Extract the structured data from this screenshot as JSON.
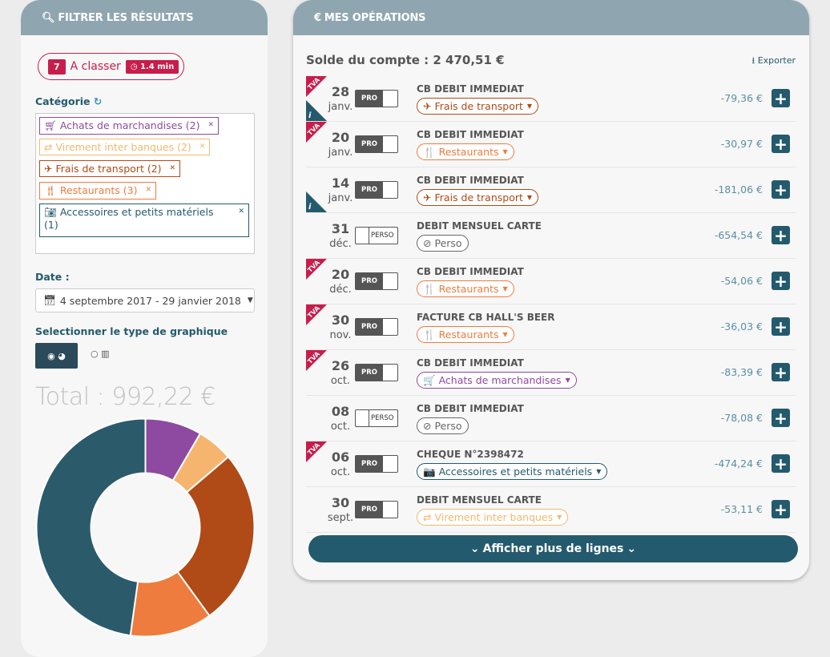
{
  "filter": {
    "title": "FILTRER LES RÉSULTATS",
    "badge_count": "7",
    "badge_label": "A classer",
    "badge_time": "1.4 min",
    "category_label": "Catégorie",
    "tags": [
      {
        "label": "Achats de marchandises (2)",
        "color": "#8e4aa0"
      },
      {
        "label": "Virement inter banques (2)",
        "color": "#f0b96e"
      },
      {
        "label": "Frais de transport (2)",
        "color": "#b04a17"
      },
      {
        "label": "Restaurants (3)",
        "color": "#ed7c3e"
      },
      {
        "label": "Accessoires et petits matériels (1)",
        "color": "#245a6e"
      }
    ],
    "date_label": "Date :",
    "date_value": "4 septembre 2017 - 29 janvier 2018",
    "graph_label": "Selectionner le type de graphique",
    "total": "Total : 992,22 €"
  },
  "chart_data": {
    "type": "pie",
    "categories": [
      "Achats de marchandises",
      "Virement inter banques",
      "Frais de transport",
      "Restaurants",
      "Accessoires et petits matériels"
    ],
    "values": [
      83.39,
      53.11,
      260.42,
      121.06,
      474.24
    ],
    "colors": [
      "#8e4aa0",
      "#f6b56f",
      "#b04a17",
      "#ed7c3e",
      "#2b5a6b"
    ]
  },
  "operations": {
    "title": "MES OPÉRATIONS",
    "solde": "Solde du compte : 2 470,51 €",
    "export": "Exporter",
    "more": "Afficher plus de lignes",
    "rows": [
      {
        "day": "28",
        "month": "janv.",
        "tva": true,
        "info": true,
        "type": "PRO",
        "label": "CB DEBIT IMMEDIAT",
        "cat": "Frais de transport",
        "cat_color": "#b04a17",
        "icon": "✈",
        "amount": "-79,36 €"
      },
      {
        "day": "20",
        "month": "janv.",
        "tva": true,
        "info": false,
        "type": "PRO",
        "label": "CB DEBIT IMMEDIAT",
        "cat": "Restaurants",
        "cat_color": "#ed7c3e",
        "icon": "🍴",
        "amount": "-30,97 €"
      },
      {
        "day": "14",
        "month": "janv.",
        "tva": false,
        "info": true,
        "type": "PRO",
        "label": "CB DEBIT IMMEDIAT",
        "cat": "Frais de transport",
        "cat_color": "#b04a17",
        "icon": "✈",
        "amount": "-181,06 €"
      },
      {
        "day": "31",
        "month": "déc.",
        "tva": false,
        "info": false,
        "type": "PERSO",
        "label": "DEBIT MENSUEL CARTE",
        "cat": "Perso",
        "cat_color": "#666666",
        "icon": "⊘",
        "amount": "-654,54 €"
      },
      {
        "day": "20",
        "month": "déc.",
        "tva": true,
        "info": false,
        "type": "PRO",
        "label": "CB DEBIT IMMEDIAT",
        "cat": "Restaurants",
        "cat_color": "#ed7c3e",
        "icon": "🍴",
        "amount": "-54,06 €"
      },
      {
        "day": "30",
        "month": "nov.",
        "tva": true,
        "info": false,
        "type": "PRO",
        "label": "FACTURE CB HALL'S BEER",
        "cat": "Restaurants",
        "cat_color": "#ed7c3e",
        "icon": "🍴",
        "amount": "-36,03 €"
      },
      {
        "day": "26",
        "month": "oct.",
        "tva": true,
        "info": false,
        "type": "PRO",
        "label": "CB DEBIT IMMEDIAT",
        "cat": "Achats de marchandises",
        "cat_color": "#8e4aa0",
        "icon": "🛒",
        "amount": "-83,39 €"
      },
      {
        "day": "08",
        "month": "oct.",
        "tva": false,
        "info": false,
        "type": "PERSO",
        "label": "CB DEBIT IMMEDIAT",
        "cat": "Perso",
        "cat_color": "#666666",
        "icon": "⊘",
        "amount": "-78,08 €"
      },
      {
        "day": "06",
        "month": "oct.",
        "tva": true,
        "info": false,
        "type": "PRO",
        "label": "CHEQUE N°2398472",
        "cat": "Accessoires et petits matériels",
        "cat_color": "#245a6e",
        "icon": "📷",
        "amount": "-474,24 €"
      },
      {
        "day": "30",
        "month": "sept.",
        "tva": false,
        "info": false,
        "type": "PRO",
        "label": "DEBIT MENSUEL CARTE",
        "cat": "Virement inter banques",
        "cat_color": "#f0b96e",
        "icon": "⇄",
        "amount": "-53,11 €"
      }
    ]
  }
}
